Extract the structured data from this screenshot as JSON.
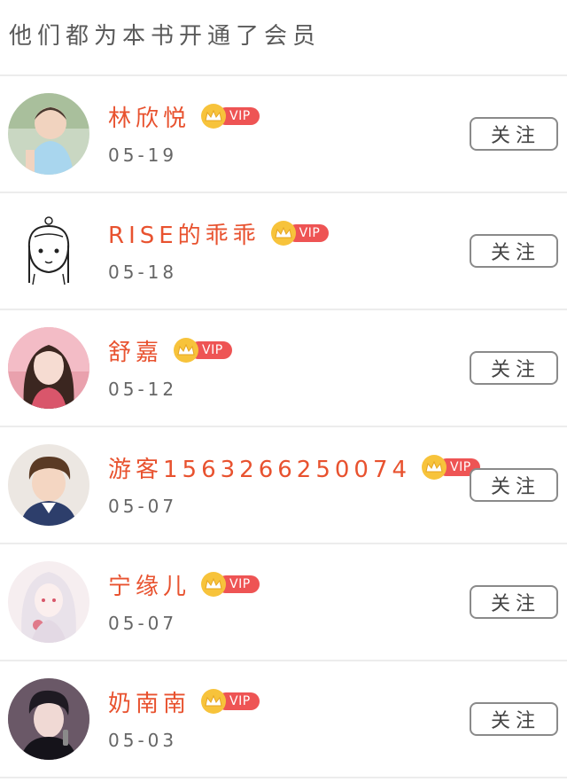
{
  "header": {
    "title": "他们都为本书开通了会员"
  },
  "members": [
    {
      "name": "林欣悦",
      "date": "05-19",
      "vip_label": "VIP",
      "follow_label": "关注",
      "avatar": "photo-child"
    },
    {
      "name": "RISE的乖乖",
      "date": "05-18",
      "vip_label": "VIP",
      "follow_label": "关注",
      "avatar": "sketch-girl"
    },
    {
      "name": "舒嘉",
      "date": "05-12",
      "vip_label": "VIP",
      "follow_label": "关注",
      "avatar": "photo-girl-pink"
    },
    {
      "name": "游客1563266250074",
      "date": "05-07",
      "vip_label": "VIP",
      "follow_label": "关注",
      "avatar": "photo-boy"
    },
    {
      "name": "宁缘儿",
      "date": "05-07",
      "vip_label": "VIP",
      "follow_label": "关注",
      "avatar": "anime-girl"
    },
    {
      "name": "奶南南",
      "date": "05-03",
      "vip_label": "VIP",
      "follow_label": "关注",
      "avatar": "photo-singer"
    }
  ],
  "colors": {
    "name": "#e8522f",
    "vip_badge": "#ee5454",
    "crown": "#f7c33b",
    "divider": "#ececec"
  }
}
